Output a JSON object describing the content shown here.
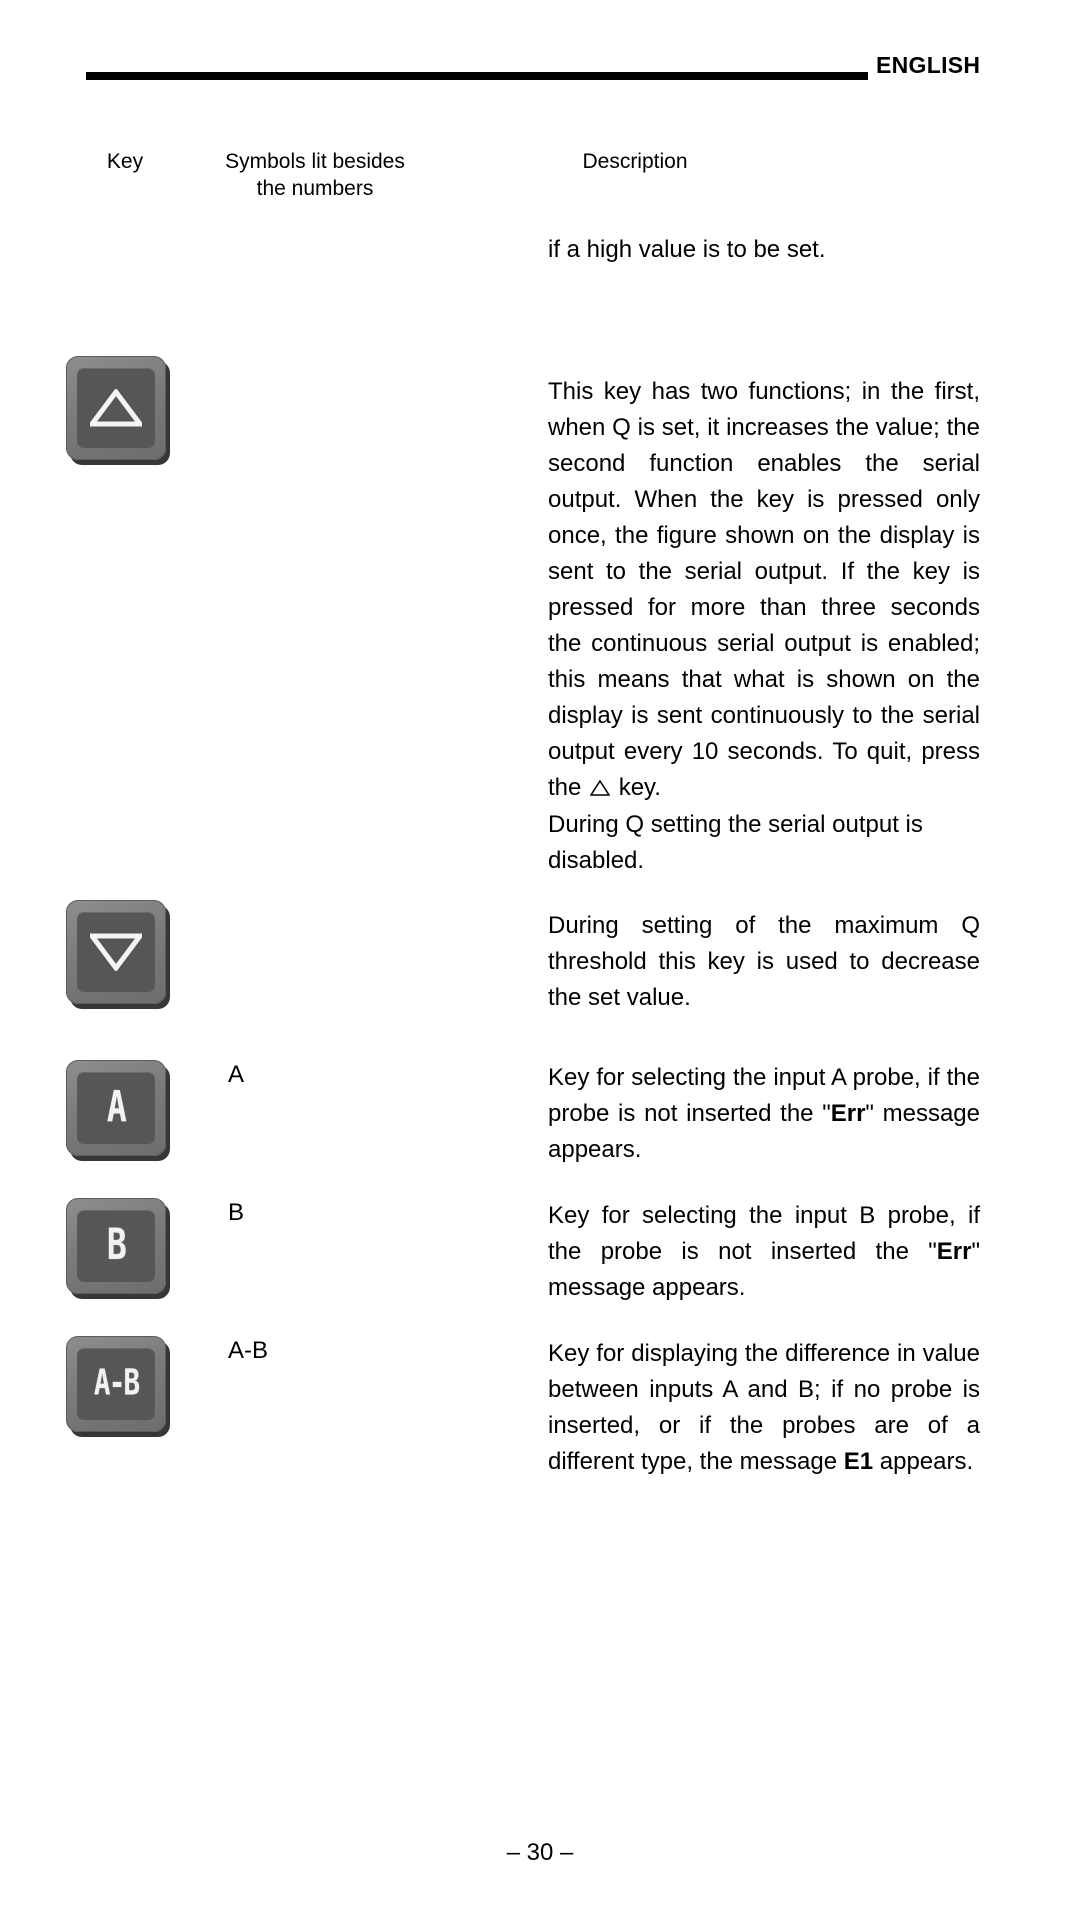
{
  "header": {
    "language_label": "ENGLISH"
  },
  "columns": {
    "key": "Key",
    "symbols_line1": "Symbols lit besides",
    "symbols_line2": "the numbers",
    "description": "Description"
  },
  "rows": [
    {
      "key_icon": "",
      "symbol": "",
      "desc": "if a high value is to be set."
    },
    {
      "key_icon": "up-triangle-key",
      "symbol": "",
      "desc_part1": "This key has two functions; in the first, when Q is set, it increases the value; the second function enables the serial output. When the key is pressed only once, the figure shown on the display is sent to the serial output. If the key is pressed for more than three seconds the continuous serial output is enabled; this means that what is shown on the display is sent continuously to the serial output every 10 seconds. To quit, press the ",
      "desc_part2": " key.",
      "desc_part3": "During Q setting the serial output is disabled."
    },
    {
      "key_icon": "down-triangle-key",
      "symbol": "",
      "desc": "During setting of the maximum Q threshold this key is used to decrease the set value."
    },
    {
      "key_icon": "a-key",
      "key_glyph": "A",
      "symbol": "A",
      "desc_pre": "Key for selecting the input A probe, if the probe is not inserted the \"",
      "desc_bold": "Err",
      "desc_post": "\" message appears."
    },
    {
      "key_icon": "b-key",
      "key_glyph": "B",
      "symbol": "B",
      "desc_pre": "Key for selecting the input B probe, if the probe is not inserted the \"",
      "desc_bold": "Err",
      "desc_post": "\" message appears."
    },
    {
      "key_icon": "a-minus-b-key",
      "key_glyph": "A-B",
      "symbol": "A-B",
      "desc_pre": "Key for displaying the difference in value between inputs A and B; if no probe is inserted, or if the probes are of a different type, the message ",
      "desc_bold": "E1",
      "desc_post": " appears."
    }
  ],
  "footer": {
    "page_number": "– 30 –"
  }
}
